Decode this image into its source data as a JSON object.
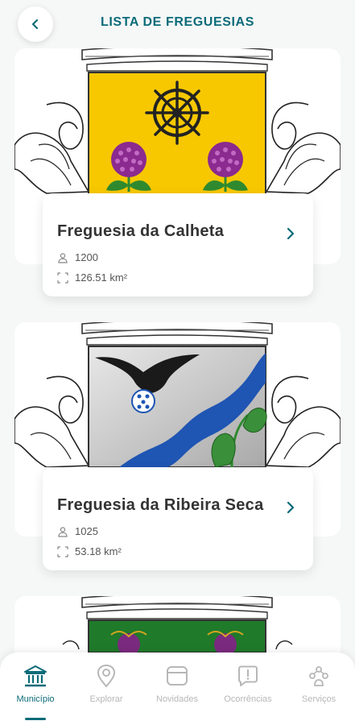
{
  "header": {
    "title": "LISTA DE FREGUESIAS"
  },
  "parishes": [
    {
      "name": "Freguesia da Calheta",
      "population": "1200",
      "area": "126.51 km²"
    },
    {
      "name": "Freguesia da Ribeira Seca",
      "population": "1025",
      "area": "53.18 km²"
    },
    {
      "name": ""
    }
  ],
  "nav": [
    {
      "label": "Município",
      "icon": "town-hall-icon",
      "active": true
    },
    {
      "label": "Explorar",
      "icon": "map-pin-icon",
      "active": false
    },
    {
      "label": "Novidades",
      "icon": "news-icon",
      "active": false
    },
    {
      "label": "Ocorrências",
      "icon": "alert-chat-icon",
      "active": false
    },
    {
      "label": "Serviços",
      "icon": "services-icon",
      "active": false
    }
  ],
  "colors": {
    "accent": "#0b6b78",
    "inactive": "#b7b7b7"
  }
}
